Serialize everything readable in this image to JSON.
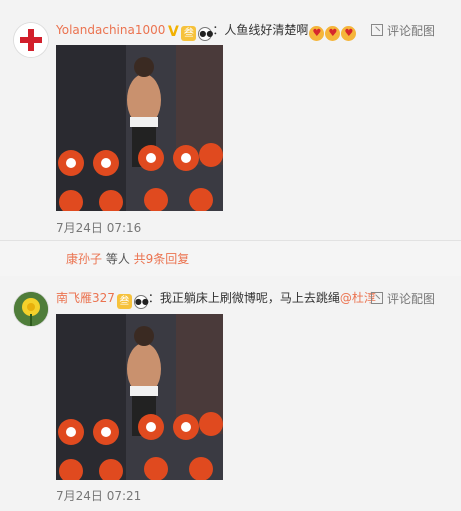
{
  "comment1": {
    "username": "Yolandachina1000",
    "vip": "V",
    "level": "叁",
    "text": "：人鱼线好清楚啊",
    "emojis": [
      "♥",
      "♥",
      "♥"
    ],
    "action_label": "评论配图",
    "time": "7月24日 07:16"
  },
  "replies": {
    "user": "康孙子",
    "middle": " 等人 ",
    "more": "共9条回复"
  },
  "comment2": {
    "username": "南飞雁327",
    "level": "叁",
    "text": "：我正躺床上刷微博呢，马上去跳绳",
    "mention": "@杜淳",
    "action_label": "评论配图",
    "time": "7月24日 07:21"
  },
  "icons": {
    "avatar1": "red-cross-avatar",
    "avatar2": "dandelion-avatar",
    "action": "image-icon",
    "panda": "panda-icon"
  },
  "colors": {
    "username": "#eb7350",
    "background": "#f3f3f3",
    "vip": "#f2b100"
  }
}
